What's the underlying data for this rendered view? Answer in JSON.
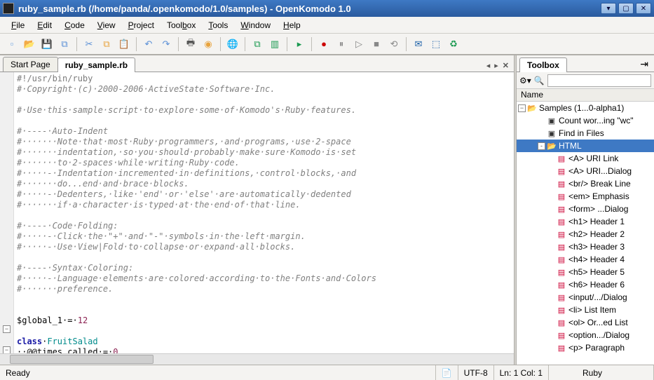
{
  "window": {
    "title": "ruby_sample.rb (/home/panda/.openkomodo/1.0/samples) - OpenKomodo 1.0"
  },
  "menus": [
    {
      "label": "File",
      "u": 0
    },
    {
      "label": "Edit",
      "u": 0
    },
    {
      "label": "Code",
      "u": 0
    },
    {
      "label": "View",
      "u": 0
    },
    {
      "label": "Project",
      "u": 0
    },
    {
      "label": "Toolbox",
      "u": 4
    },
    {
      "label": "Tools",
      "u": 0
    },
    {
      "label": "Window",
      "u": 0
    },
    {
      "label": "Help",
      "u": 0
    }
  ],
  "toolbar_icons": [
    {
      "name": "new-file-icon",
      "glyph": "▫",
      "color": "#6aa1e0"
    },
    {
      "name": "open-icon",
      "glyph": "📂",
      "color": "#e8a33d"
    },
    {
      "name": "save-icon",
      "glyph": "💾",
      "color": "#5a8fd6"
    },
    {
      "name": "save-all-icon",
      "glyph": "⧉",
      "color": "#5a8fd6"
    },
    {
      "name": "sep"
    },
    {
      "name": "cut-icon",
      "glyph": "✂",
      "color": "#5a8fd6"
    },
    {
      "name": "copy-icon",
      "glyph": "⧉",
      "color": "#e8a33d"
    },
    {
      "name": "paste-icon",
      "glyph": "📋",
      "color": "#e8a33d"
    },
    {
      "name": "sep"
    },
    {
      "name": "undo-icon",
      "glyph": "↶",
      "color": "#5a8fd6"
    },
    {
      "name": "redo-icon",
      "glyph": "↷",
      "color": "#5a8fd6"
    },
    {
      "name": "sep"
    },
    {
      "name": "print-icon",
      "glyph": "🖶",
      "color": "#555"
    },
    {
      "name": "help-icon",
      "glyph": "◉",
      "color": "#e8a33d"
    },
    {
      "name": "sep"
    },
    {
      "name": "browser-icon",
      "glyph": "🌐",
      "color": "#1a7aa8"
    },
    {
      "name": "sep"
    },
    {
      "name": "preview-icon",
      "glyph": "⧉",
      "color": "#1a9950"
    },
    {
      "name": "preview-split-icon",
      "glyph": "▥",
      "color": "#1a9950"
    },
    {
      "name": "sep"
    },
    {
      "name": "run-menu-icon",
      "glyph": "▸",
      "color": "#1a9950"
    },
    {
      "name": "sep"
    },
    {
      "name": "record-icon",
      "glyph": "●",
      "color": "#c00"
    },
    {
      "name": "pause-icon",
      "glyph": "⏸",
      "color": "#888"
    },
    {
      "name": "play-icon",
      "glyph": "▷",
      "color": "#888"
    },
    {
      "name": "stop-icon",
      "glyph": "■",
      "color": "#888"
    },
    {
      "name": "replay-icon",
      "glyph": "⟲",
      "color": "#888"
    },
    {
      "name": "sep"
    },
    {
      "name": "mail-icon",
      "glyph": "✉",
      "color": "#1a5fa8"
    },
    {
      "name": "package-icon",
      "glyph": "⬚",
      "color": "#1a5fa8"
    },
    {
      "name": "sync-icon",
      "glyph": "♻",
      "color": "#1a9950"
    }
  ],
  "tabs": {
    "start_page": "Start Page",
    "active": "ruby_sample.rb"
  },
  "code_lines": [
    {
      "cls": "c-shebang",
      "t": "#!/usr/bin/ruby"
    },
    {
      "cls": "c-comment",
      "t": "#·Copyright·(c)·2000-2006·ActiveState·Software·Inc."
    },
    {
      "cls": "",
      "t": ""
    },
    {
      "cls": "c-comment",
      "t": "#·Use·this·sample·script·to·explore·some·of·Komodo's·Ruby·features."
    },
    {
      "cls": "",
      "t": ""
    },
    {
      "cls": "c-comment",
      "t": "#·----·Auto-Indent"
    },
    {
      "cls": "c-comment",
      "t": "#·······Note·that·most·Ruby·programmers,·and·programs,·use·2-space"
    },
    {
      "cls": "c-comment",
      "t": "#·······indentation,·so·you·should·probably·make·sure·Komodo·is·set"
    },
    {
      "cls": "c-comment",
      "t": "#·······to·2-spaces·while·writing·Ruby·code."
    },
    {
      "cls": "c-comment",
      "t": "#·····-·Indentation·incremented·in·definitions,·control·blocks,·and"
    },
    {
      "cls": "c-comment",
      "t": "#·······do...end·and·brace·blocks."
    },
    {
      "cls": "c-comment",
      "t": "#·····-·Dedenters,·like·'end'·or·'else'·are·automatically·dedented"
    },
    {
      "cls": "c-comment",
      "t": "#·······if·a·character·is·typed·at·the·end·of·that·line."
    },
    {
      "cls": "",
      "t": ""
    },
    {
      "cls": "c-comment",
      "t": "#·----·Code·Folding:"
    },
    {
      "cls": "c-comment",
      "t": "#·····-·Click·the·\"+\"·and·\"-\"·symbols·in·the·left·margin."
    },
    {
      "cls": "c-comment",
      "t": "#·····-·Use·View|Fold·to·collapse·or·expand·all·blocks."
    },
    {
      "cls": "",
      "t": ""
    },
    {
      "cls": "c-comment",
      "t": "#·----·Syntax·Coloring:"
    },
    {
      "cls": "c-comment",
      "t": "#·····-·Language·elements·are·colored·according·to·the·Fonts·and·Colors"
    },
    {
      "cls": "c-comment",
      "t": "#·······preference."
    },
    {
      "cls": "",
      "t": ""
    },
    {
      "cls": "",
      "t": ""
    },
    {
      "html": "<span class='c-var'>$global_1</span>·=·<span class='c-num'>12</span>"
    },
    {
      "cls": "",
      "t": ""
    },
    {
      "html": "<span class='c-kw'>class</span>·<span class='c-class'>FruitSalad</span>"
    },
    {
      "html": "··<span class='c-var'>@@times_called</span>·=·<span class='c-num'>0</span>"
    }
  ],
  "toolbox": {
    "title": "Toolbox",
    "name_header": "Name",
    "root": "Samples (1...0-alpha1)",
    "items": [
      {
        "icon": "cmd",
        "label": "Count wor...ing \"wc\"",
        "indent": 2
      },
      {
        "icon": "cmd",
        "label": "Find in Files",
        "indent": 2
      },
      {
        "icon": "folder-open",
        "label": "HTML",
        "indent": 2,
        "selected": true,
        "twist": "-"
      },
      {
        "icon": "snip",
        "label": "<A> URI Link",
        "indent": 3
      },
      {
        "icon": "snip",
        "label": "<A> URI...Dialog",
        "indent": 3
      },
      {
        "icon": "snip",
        "label": "<br/> Break Line",
        "indent": 3
      },
      {
        "icon": "snip",
        "label": "<em> Emphasis",
        "indent": 3
      },
      {
        "icon": "snip",
        "label": "<form> ...Dialog",
        "indent": 3
      },
      {
        "icon": "snip",
        "label": "<h1> Header 1",
        "indent": 3
      },
      {
        "icon": "snip",
        "label": "<h2> Header 2",
        "indent": 3
      },
      {
        "icon": "snip",
        "label": "<h3> Header 3",
        "indent": 3
      },
      {
        "icon": "snip",
        "label": "<h4> Header 4",
        "indent": 3
      },
      {
        "icon": "snip",
        "label": "<h5> Header 5",
        "indent": 3
      },
      {
        "icon": "snip",
        "label": "<h6> Header 6",
        "indent": 3
      },
      {
        "icon": "snip",
        "label": "<input/.../Dialog",
        "indent": 3
      },
      {
        "icon": "snip",
        "label": "<li> List Item",
        "indent": 3
      },
      {
        "icon": "snip",
        "label": "<ol> Or...ed List",
        "indent": 3
      },
      {
        "icon": "snip",
        "label": "<option.../Dialog",
        "indent": 3
      },
      {
        "icon": "snip",
        "label": "<p> Paragraph",
        "indent": 3
      }
    ]
  },
  "status": {
    "ready": "Ready",
    "encoding": "UTF-8",
    "pos": "Ln: 1 Col: 1",
    "lang": "Ruby"
  }
}
